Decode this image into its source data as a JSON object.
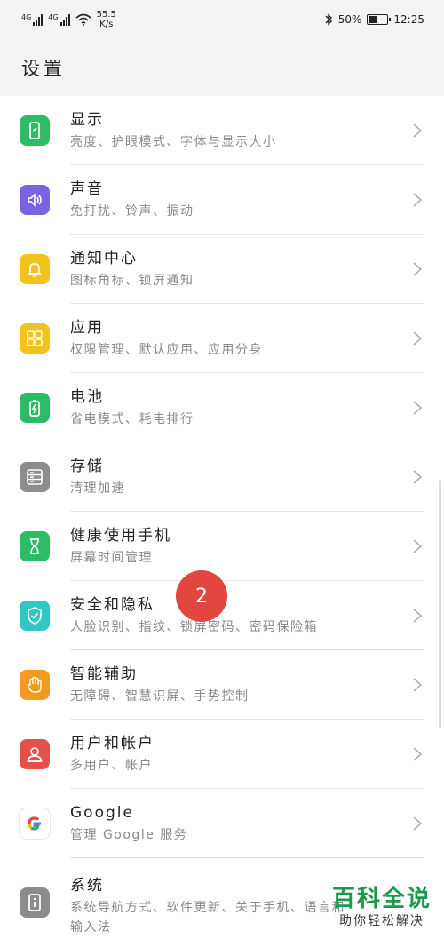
{
  "status_bar": {
    "signal1_label": "4G",
    "signal2_label": "4G",
    "speed_value": "55.5",
    "speed_unit": "K/s",
    "battery_percent": "50%",
    "battery_level": 0.5,
    "time": "12:25"
  },
  "header": {
    "title": "设置"
  },
  "items": [
    {
      "title": "显示",
      "subtitle": "亮度、护眼模式、字体与显示大小",
      "icon": "display-icon",
      "color": "#2dbb66"
    },
    {
      "title": "声音",
      "subtitle": "免打扰、铃声、振动",
      "icon": "speaker-icon",
      "color": "#7b63e0"
    },
    {
      "title": "通知中心",
      "subtitle": "图标角标、锁屏通知",
      "icon": "bell-icon",
      "color": "#f4c21d"
    },
    {
      "title": "应用",
      "subtitle": "权限管理、默认应用、应用分身",
      "icon": "apps-grid-icon",
      "color": "#f4c21d"
    },
    {
      "title": "电池",
      "subtitle": "省电模式、耗电排行",
      "icon": "battery-icon",
      "color": "#2dbb66"
    },
    {
      "title": "存储",
      "subtitle": "清理加速",
      "icon": "storage-icon",
      "color": "#8c8c8c"
    },
    {
      "title": "健康使用手机",
      "subtitle": "屏幕时间管理",
      "icon": "hourglass-icon",
      "color": "#2dbb66"
    },
    {
      "title": "安全和隐私",
      "subtitle": "人脸识别、指纹、锁屏密码、密码保险箱",
      "icon": "shield-icon",
      "color": "#2fc6c6"
    },
    {
      "title": "智能辅助",
      "subtitle": "无障碍、智慧识屏、手势控制",
      "icon": "hand-icon",
      "color": "#f49a23"
    },
    {
      "title": "用户和帐户",
      "subtitle": "多用户、帐户",
      "icon": "user-icon",
      "color": "#e5504a"
    },
    {
      "title": "Google",
      "subtitle": "管理 Google 服务",
      "icon": "google-icon",
      "color": "#ffffff"
    },
    {
      "title": "系统",
      "subtitle": "系统导航方式、软件更新、关于手机、语言和",
      "subtitle2": "输入法",
      "icon": "system-info-icon",
      "color": "#8c8c8c"
    }
  ],
  "badge": {
    "label": "2"
  },
  "watermark": {
    "title": "百科全说",
    "subtitle": "助你轻松解决"
  }
}
